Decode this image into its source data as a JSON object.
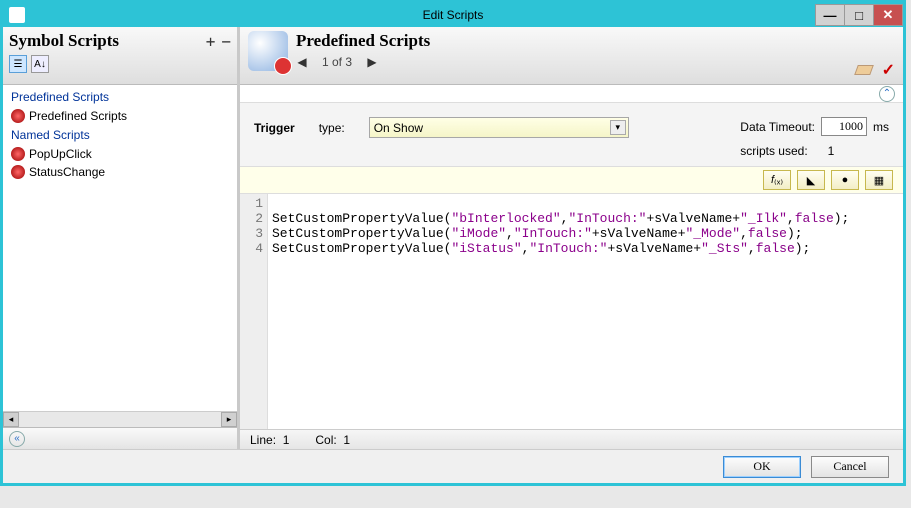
{
  "window": {
    "title": "Edit Scripts"
  },
  "sidebar": {
    "title": "Symbol Scripts",
    "groups": [
      {
        "heading": "Predefined Scripts",
        "items": [
          {
            "label": "Predefined Scripts"
          }
        ]
      },
      {
        "heading": "Named Scripts",
        "items": [
          {
            "label": "PopUpClick"
          },
          {
            "label": "StatusChange"
          }
        ]
      }
    ]
  },
  "header": {
    "title": "Predefined Scripts",
    "nav_position": "1 of 3"
  },
  "trigger": {
    "section_label": "Trigger",
    "type_label": "type:",
    "type_value": "On Show",
    "data_timeout_label": "Data Timeout:",
    "data_timeout_value": "1000",
    "data_timeout_unit": "ms",
    "scripts_used_label": "scripts used:",
    "scripts_used_value": "1"
  },
  "editor": {
    "lines": [
      "",
      "SetCustomPropertyValue(\"bInterlocked\",\"InTouch:\"+sValveName+\"_Ilk\",false);",
      "SetCustomPropertyValue(\"iMode\",\"InTouch:\"+sValveName+\"_Mode\",false);",
      "SetCustomPropertyValue(\"iStatus\",\"InTouch:\"+sValveName+\"_Sts\",false);"
    ],
    "status_line_label": "Line:",
    "status_line_value": "1",
    "status_col_label": "Col:",
    "status_col_value": "1"
  },
  "footer": {
    "ok": "OK",
    "cancel": "Cancel"
  }
}
